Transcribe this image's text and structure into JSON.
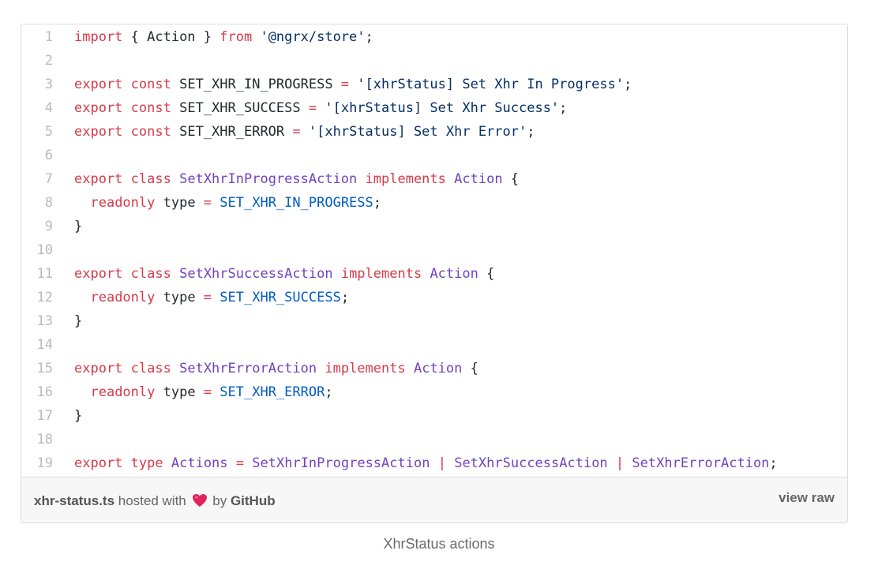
{
  "code": {
    "lines": [
      {
        "num": "1",
        "tokens": [
          {
            "t": "import",
            "c": "kw"
          },
          {
            "t": " { Action } ",
            "c": "pl"
          },
          {
            "t": "from",
            "c": "kw"
          },
          {
            "t": " ",
            "c": "pl"
          },
          {
            "t": "'@ngrx/store'",
            "c": "str"
          },
          {
            "t": ";",
            "c": "pl"
          }
        ]
      },
      {
        "num": "2",
        "tokens": []
      },
      {
        "num": "3",
        "tokens": [
          {
            "t": "export",
            "c": "kw"
          },
          {
            "t": " ",
            "c": "pl"
          },
          {
            "t": "const",
            "c": "kw"
          },
          {
            "t": " SET_XHR_IN_PROGRESS ",
            "c": "pl"
          },
          {
            "t": "=",
            "c": "op"
          },
          {
            "t": " ",
            "c": "pl"
          },
          {
            "t": "'[xhrStatus] Set Xhr In Progress'",
            "c": "str"
          },
          {
            "t": ";",
            "c": "pl"
          }
        ]
      },
      {
        "num": "4",
        "tokens": [
          {
            "t": "export",
            "c": "kw"
          },
          {
            "t": " ",
            "c": "pl"
          },
          {
            "t": "const",
            "c": "kw"
          },
          {
            "t": " SET_XHR_SUCCESS ",
            "c": "pl"
          },
          {
            "t": "=",
            "c": "op"
          },
          {
            "t": " ",
            "c": "pl"
          },
          {
            "t": "'[xhrStatus] Set Xhr Success'",
            "c": "str"
          },
          {
            "t": ";",
            "c": "pl"
          }
        ]
      },
      {
        "num": "5",
        "tokens": [
          {
            "t": "export",
            "c": "kw"
          },
          {
            "t": " ",
            "c": "pl"
          },
          {
            "t": "const",
            "c": "kw"
          },
          {
            "t": " SET_XHR_ERROR ",
            "c": "pl"
          },
          {
            "t": "=",
            "c": "op"
          },
          {
            "t": " ",
            "c": "pl"
          },
          {
            "t": "'[xhrStatus] Set Xhr Error'",
            "c": "str"
          },
          {
            "t": ";",
            "c": "pl"
          }
        ]
      },
      {
        "num": "6",
        "tokens": []
      },
      {
        "num": "7",
        "tokens": [
          {
            "t": "export",
            "c": "kw"
          },
          {
            "t": " ",
            "c": "pl"
          },
          {
            "t": "class",
            "c": "kw"
          },
          {
            "t": " ",
            "c": "pl"
          },
          {
            "t": "SetXhrInProgressAction",
            "c": "cls"
          },
          {
            "t": " ",
            "c": "pl"
          },
          {
            "t": "implements",
            "c": "kw"
          },
          {
            "t": " ",
            "c": "pl"
          },
          {
            "t": "Action",
            "c": "cls"
          },
          {
            "t": " {",
            "c": "pl"
          }
        ]
      },
      {
        "num": "8",
        "tokens": [
          {
            "t": "  ",
            "c": "pl"
          },
          {
            "t": "readonly",
            "c": "kw"
          },
          {
            "t": " type ",
            "c": "pl"
          },
          {
            "t": "=",
            "c": "op"
          },
          {
            "t": " ",
            "c": "pl"
          },
          {
            "t": "SET_XHR_IN_PROGRESS",
            "c": "con"
          },
          {
            "t": ";",
            "c": "pl"
          }
        ]
      },
      {
        "num": "9",
        "tokens": [
          {
            "t": "}",
            "c": "pl"
          }
        ]
      },
      {
        "num": "10",
        "tokens": []
      },
      {
        "num": "11",
        "tokens": [
          {
            "t": "export",
            "c": "kw"
          },
          {
            "t": " ",
            "c": "pl"
          },
          {
            "t": "class",
            "c": "kw"
          },
          {
            "t": " ",
            "c": "pl"
          },
          {
            "t": "SetXhrSuccessAction",
            "c": "cls"
          },
          {
            "t": " ",
            "c": "pl"
          },
          {
            "t": "implements",
            "c": "kw"
          },
          {
            "t": " ",
            "c": "pl"
          },
          {
            "t": "Action",
            "c": "cls"
          },
          {
            "t": " {",
            "c": "pl"
          }
        ]
      },
      {
        "num": "12",
        "tokens": [
          {
            "t": "  ",
            "c": "pl"
          },
          {
            "t": "readonly",
            "c": "kw"
          },
          {
            "t": " type ",
            "c": "pl"
          },
          {
            "t": "=",
            "c": "op"
          },
          {
            "t": " ",
            "c": "pl"
          },
          {
            "t": "SET_XHR_SUCCESS",
            "c": "con"
          },
          {
            "t": ";",
            "c": "pl"
          }
        ]
      },
      {
        "num": "13",
        "tokens": [
          {
            "t": "}",
            "c": "pl"
          }
        ]
      },
      {
        "num": "14",
        "tokens": []
      },
      {
        "num": "15",
        "tokens": [
          {
            "t": "export",
            "c": "kw"
          },
          {
            "t": " ",
            "c": "pl"
          },
          {
            "t": "class",
            "c": "kw"
          },
          {
            "t": " ",
            "c": "pl"
          },
          {
            "t": "SetXhrErrorAction",
            "c": "cls"
          },
          {
            "t": " ",
            "c": "pl"
          },
          {
            "t": "implements",
            "c": "kw"
          },
          {
            "t": " ",
            "c": "pl"
          },
          {
            "t": "Action",
            "c": "cls"
          },
          {
            "t": " {",
            "c": "pl"
          }
        ]
      },
      {
        "num": "16",
        "tokens": [
          {
            "t": "  ",
            "c": "pl"
          },
          {
            "t": "readonly",
            "c": "kw"
          },
          {
            "t": " type ",
            "c": "pl"
          },
          {
            "t": "=",
            "c": "op"
          },
          {
            "t": " ",
            "c": "pl"
          },
          {
            "t": "SET_XHR_ERROR",
            "c": "con"
          },
          {
            "t": ";",
            "c": "pl"
          }
        ]
      },
      {
        "num": "17",
        "tokens": [
          {
            "t": "}",
            "c": "pl"
          }
        ]
      },
      {
        "num": "18",
        "tokens": []
      },
      {
        "num": "19",
        "tokens": [
          {
            "t": "export",
            "c": "kw"
          },
          {
            "t": " ",
            "c": "pl"
          },
          {
            "t": "type",
            "c": "kw"
          },
          {
            "t": " ",
            "c": "pl"
          },
          {
            "t": "Actions",
            "c": "cls"
          },
          {
            "t": " ",
            "c": "pl"
          },
          {
            "t": "=",
            "c": "op"
          },
          {
            "t": " ",
            "c": "pl"
          },
          {
            "t": "SetXhrInProgressAction",
            "c": "cls"
          },
          {
            "t": " ",
            "c": "pl"
          },
          {
            "t": "|",
            "c": "op"
          },
          {
            "t": " ",
            "c": "pl"
          },
          {
            "t": "SetXhrSuccessAction",
            "c": "cls"
          },
          {
            "t": " ",
            "c": "pl"
          },
          {
            "t": "|",
            "c": "op"
          },
          {
            "t": " ",
            "c": "pl"
          },
          {
            "t": "SetXhrErrorAction",
            "c": "cls"
          },
          {
            "t": ";",
            "c": "pl"
          }
        ]
      }
    ]
  },
  "meta": {
    "filename": "xhr-status.ts",
    "hosted_with": "hosted with",
    "by": "by",
    "host": "GitHub",
    "heart_icon": "heart-icon",
    "view_raw": "view raw"
  },
  "caption": "XhrStatus actions",
  "colors": {
    "keyword": "#d73a49",
    "string": "#032f62",
    "class_name": "#6f42c1",
    "constant": "#005cc5",
    "heart": "#e0245e"
  }
}
